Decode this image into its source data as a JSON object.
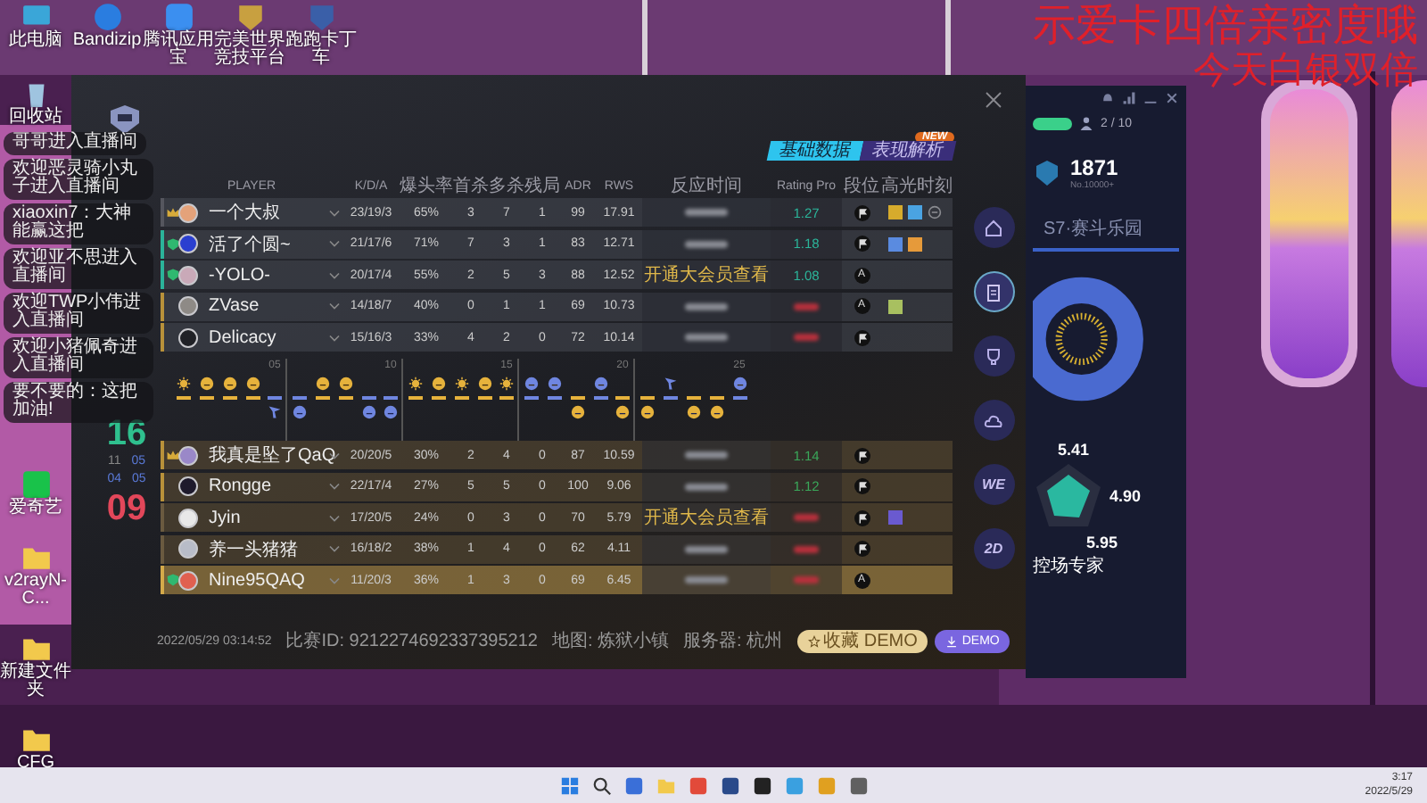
{
  "overlay_text": [
    "示爱卡四倍亲密度哦",
    "今天白银双倍"
  ],
  "desktop_top": [
    {
      "label": "此电脑",
      "kind": "monitor",
      "color": "#3aa6d8"
    },
    {
      "label": "Bandizip",
      "kind": "bolt",
      "color": "#2a7de0"
    },
    {
      "label": "腾讯应用宝",
      "kind": "mountain",
      "color": "#3b8ff0"
    },
    {
      "label": "完美世界竞技平台",
      "kind": "badge",
      "color": "#c8a040"
    },
    {
      "label": "跑跑卡丁车",
      "kind": "badge",
      "color": "#3a5fa8"
    }
  ],
  "desktop_left": [
    {
      "label": "回收站",
      "kind": "bin",
      "color": "#9fc4e0"
    },
    {
      "label": "爱奇艺",
      "kind": "tv",
      "color": "#19c24a"
    },
    {
      "label": "v2rayN-C...",
      "kind": "folder",
      "color": "#f2c94c"
    },
    {
      "label": "新建文件夹",
      "kind": "folder",
      "color": "#f2c94c"
    },
    {
      "label": "CFG",
      "kind": "folder",
      "color": "#f2c94c"
    }
  ],
  "chat": [
    "哥哥进入直播间",
    "欢迎恶灵骑小丸子进入直播间",
    "xiaoxin7：大神能赢这把",
    "欢迎亚不思进入直播间",
    "欢迎TWP小伟进入直播间",
    "欢迎小猪佩奇进入直播间",
    "要不要的：这把加油!"
  ],
  "match": {
    "tabs": [
      {
        "label": "基础数据",
        "selected": true
      },
      {
        "label": "表现解析",
        "selected": false
      }
    ],
    "new_badge": "NEW",
    "columns": [
      "PLAYER",
      "K/D/A",
      "爆头率",
      "首杀",
      "多杀",
      "残局",
      "ADR",
      "RWS",
      "反应时间",
      "Rating Pro",
      "段位",
      "高光时刻"
    ],
    "teams": [
      {
        "score": "16",
        "color": "#2fc08e",
        "halves": [
          "11",
          "05"
        ],
        "players": [
          {
            "badge": {
              "kind": "mvp"
            },
            "color": "#55565e",
            "avatar": {
              "color": "#e4a27a"
            },
            "name": "一个大叔",
            "kda": "23/19/3",
            "hs": "65%",
            "fk": "3",
            "mk": "7",
            "clutch": "1",
            "adr": "99",
            "rws": "17.91",
            "reaction": {
              "kind": "blurred"
            },
            "rating": {
              "kind": "text",
              "text": "1.27",
              "color": "#2bb59a"
            },
            "rank": {
              "kind": "flag"
            },
            "highlights": [
              {
                "kind": "square",
                "color": "#d6ab2c"
              },
              {
                "kind": "square",
                "color": "#4aa3e2"
              },
              {
                "kind": "circle",
                "color": "#8a8b90"
              }
            ],
            "highlighted": false
          },
          {
            "badge": {
              "kind": "shield"
            },
            "color": "#2bb39a",
            "avatar": {
              "color": "#2a3fd0"
            },
            "name": "活了个圆~",
            "kda": "21/17/6",
            "hs": "71%",
            "fk": "7",
            "mk": "3",
            "clutch": "1",
            "adr": "83",
            "rws": "12.71",
            "reaction": {
              "kind": "blurred"
            },
            "rating": {
              "kind": "text",
              "text": "1.18",
              "color": "#2bb59a"
            },
            "rank": {
              "kind": "flag"
            },
            "highlights": [
              {
                "kind": "square",
                "color": "#5a8be0"
              },
              {
                "kind": "square",
                "color": "#e69a3a"
              }
            ],
            "highlighted": false
          },
          {
            "badge": {
              "kind": "shield"
            },
            "color": "#2bb39a",
            "avatar": {
              "color": "#c9a9b8"
            },
            "name": "-YOLO-",
            "kda": "20/17/4",
            "hs": "55%",
            "fk": "2",
            "mk": "5",
            "clutch": "3",
            "adr": "88",
            "rws": "12.52",
            "reaction": {
              "kind": "text",
              "text": "开通大会员查看"
            },
            "rating": {
              "kind": "text",
              "text": "1.08",
              "color": "#2bb59a"
            },
            "rank": {
              "kind": "letter",
              "text": "A"
            },
            "highlighted": false
          },
          {
            "color": "#b8913a",
            "avatar": {
              "color": "#8e8a86"
            },
            "name": "ZVase",
            "kda": "14/18/7",
            "hs": "40%",
            "fk": "0",
            "mk": "1",
            "clutch": "1",
            "adr": "69",
            "rws": "10.73",
            "reaction": {
              "kind": "blurred"
            },
            "rating": {
              "kind": "blurred",
              "color": "#b8303c"
            },
            "rank": {
              "kind": "letter",
              "text": "A"
            },
            "highlights": [
              {
                "kind": "square",
                "color": "#a8c060"
              }
            ],
            "highlighted": false
          },
          {
            "color": "#b8913a",
            "avatar": {
              "color": "#202126"
            },
            "name": "Delicacy",
            "kda": "15/16/3",
            "hs": "33%",
            "fk": "4",
            "mk": "2",
            "clutch": "0",
            "adr": "72",
            "rws": "10.14",
            "reaction": {
              "kind": "blurred"
            },
            "rating": {
              "kind": "blurred",
              "color": "#b8303c"
            },
            "rank": {
              "kind": "flag"
            },
            "highlighted": false
          }
        ]
      },
      {
        "score": "09",
        "color": "#e2475a",
        "halves": [
          "04",
          "05"
        ],
        "players": [
          {
            "badge": {
              "kind": "mvp"
            },
            "color": "#b8913a",
            "avatar": {
              "color": "#9a88c8"
            },
            "name": "我真是坠了QaQ",
            "kda": "20/20/5",
            "hs": "30%",
            "fk": "2",
            "mk": "4",
            "clutch": "0",
            "adr": "87",
            "rws": "10.59",
            "reaction": {
              "kind": "blurred"
            },
            "rating": {
              "kind": "text",
              "text": "1.14",
              "color": "#3aa85a"
            },
            "rank": {
              "kind": "flag"
            },
            "highlighted": false
          },
          {
            "color": "#b8913a",
            "avatar": {
              "color": "#1e1a2c"
            },
            "name": "Rongge",
            "kda": "22/17/4",
            "hs": "27%",
            "fk": "5",
            "mk": "5",
            "clutch": "0",
            "adr": "100",
            "rws": "9.06",
            "reaction": {
              "kind": "blurred"
            },
            "rating": {
              "kind": "text",
              "text": "1.12",
              "color": "#3aa85a"
            },
            "rank": {
              "kind": "flag"
            },
            "highlighted": false
          },
          {
            "color": "#6a5a40",
            "avatar": {
              "color": "#e8e8e8"
            },
            "name": "Jyin",
            "kda": "17/20/5",
            "hs": "24%",
            "fk": "0",
            "mk": "3",
            "clutch": "0",
            "adr": "70",
            "rws": "5.79",
            "reaction": {
              "kind": "text",
              "text": "开通大会员查看"
            },
            "rating": {
              "kind": "blurred",
              "color": "#b8303c"
            },
            "rank": {
              "kind": "flag"
            },
            "highlights": [
              {
                "kind": "square",
                "color": "#6a5ad0"
              }
            ],
            "highlighted": false
          },
          {
            "color": "#6a5a40",
            "avatar": {
              "color": "#b8bcc8"
            },
            "name": "养一头猪猪",
            "kda": "16/18/2",
            "hs": "38%",
            "fk": "1",
            "mk": "4",
            "clutch": "0",
            "adr": "62",
            "rws": "4.11",
            "reaction": {
              "kind": "blurred"
            },
            "rating": {
              "kind": "blurred",
              "color": "#b8303c"
            },
            "rank": {
              "kind": "flag"
            },
            "highlighted": false
          },
          {
            "badge": {
              "kind": "shield"
            },
            "color": "#d4aa4a",
            "avatar": {
              "color": "#e06050"
            },
            "name": "Nine95QAQ",
            "kda": "11/20/3",
            "hs": "36%",
            "fk": "1",
            "mk": "3",
            "clutch": "0",
            "adr": "69",
            "rws": "6.45",
            "reaction": {
              "kind": "blurred"
            },
            "rating": {
              "kind": "blurred",
              "color": "#b8303c"
            },
            "rank": {
              "kind": "letter",
              "text": "A"
            },
            "highlighted": true
          }
        ]
      }
    ],
    "timeline": {
      "ticks": [
        "05",
        "10",
        "15",
        "20",
        "25"
      ],
      "rounds": [
        {
          "won_top": true,
          "kind": "bomb",
          "color": "#e6b23c"
        },
        {
          "won_top": true,
          "kind": "elim",
          "color": "#e6b23c"
        },
        {
          "won_top": true,
          "kind": "elim",
          "color": "#e6b23c"
        },
        {
          "won_top": true,
          "kind": "elim",
          "color": "#e6b23c"
        },
        {
          "won_top": false,
          "kind": "pointer",
          "color": "#6f86e0"
        },
        {
          "won_top": false,
          "kind": "elim",
          "color": "#6f86e0"
        },
        {
          "won_top": true,
          "kind": "elim",
          "color": "#e6b23c"
        },
        {
          "won_top": true,
          "kind": "elim",
          "color": "#e6b23c"
        },
        {
          "won_top": false,
          "kind": "elim",
          "color": "#6f86e0"
        },
        {
          "won_top": false,
          "kind": "elim",
          "color": "#6f86e0"
        },
        {
          "won_top": true,
          "kind": "bomb",
          "color": "#e6b23c"
        },
        {
          "won_top": true,
          "kind": "elim",
          "color": "#e6b23c"
        },
        {
          "won_top": true,
          "kind": "bomb",
          "color": "#e6b23c"
        },
        {
          "won_top": true,
          "kind": "elim",
          "color": "#e6b23c"
        },
        {
          "won_top": true,
          "kind": "bomb",
          "color": "#e6b23c"
        },
        {
          "won_top": true,
          "kind": "elim",
          "color": "#6f86e0"
        },
        {
          "won_top": true,
          "kind": "elim",
          "color": "#6f86e0"
        },
        {
          "won_top": false,
          "kind": "elim",
          "color": "#e6b23c"
        },
        {
          "won_top": true,
          "kind": "elim",
          "color": "#6f86e0"
        },
        {
          "won_top": false,
          "kind": "elim",
          "color": "#e6b23c"
        },
        {
          "won_top": false,
          "kind": "elim",
          "color": "#e6b23c"
        },
        {
          "won_top": true,
          "kind": "pointer",
          "color": "#6f86e0"
        },
        {
          "won_top": false,
          "kind": "elim",
          "color": "#e6b23c"
        },
        {
          "won_top": false,
          "kind": "elim",
          "color": "#e6b23c"
        },
        {
          "won_top": true,
          "kind": "elim",
          "color": "#6f86e0"
        }
      ]
    },
    "footer": {
      "date": "2022/05/29 03:14:52",
      "match_id": "比赛ID: 9212274692337395212",
      "map": "地图: 炼狱小镇",
      "server": "服务器: 杭州",
      "buttons": [
        {
          "label": "收藏 DEMO",
          "kind": "favorite"
        },
        {
          "label": "DEMO",
          "kind": "download"
        }
      ]
    },
    "nav": [
      {
        "kind": "home",
        "selected": false
      },
      {
        "kind": "clipboard",
        "selected": true
      },
      {
        "kind": "trophy",
        "selected": false
      },
      {
        "kind": "cloud",
        "selected": false
      },
      {
        "kind": "text",
        "label": "WE",
        "selected": false
      },
      {
        "kind": "text",
        "label": "2D",
        "selected": false
      }
    ]
  },
  "side_window": {
    "counter": "2 / 10",
    "rating": "1871",
    "rank": "No.10000+",
    "season": "S7·赛斗乐园",
    "stats": [
      "5.41",
      "4.90",
      "5.95"
    ],
    "title": "控场专家"
  },
  "taskbar": {
    "apps": [
      {
        "kind": "windows",
        "color": "#2a7de0"
      },
      {
        "kind": "search",
        "color": "#333333"
      },
      {
        "kind": "tile",
        "color": "#3a6fd8"
      },
      {
        "kind": "folder",
        "color": "#f2c94c"
      },
      {
        "kind": "tile",
        "color": "#e24a3a"
      },
      {
        "kind": "tile",
        "color": "#2a4a8a"
      },
      {
        "kind": "tile",
        "color": "#222222"
      },
      {
        "kind": "tile",
        "color": "#3aa0e0"
      },
      {
        "kind": "tile",
        "color": "#e0a020"
      },
      {
        "kind": "tile",
        "color": "#606060"
      }
    ],
    "time": "3:17",
    "date": "2022/5/29"
  }
}
